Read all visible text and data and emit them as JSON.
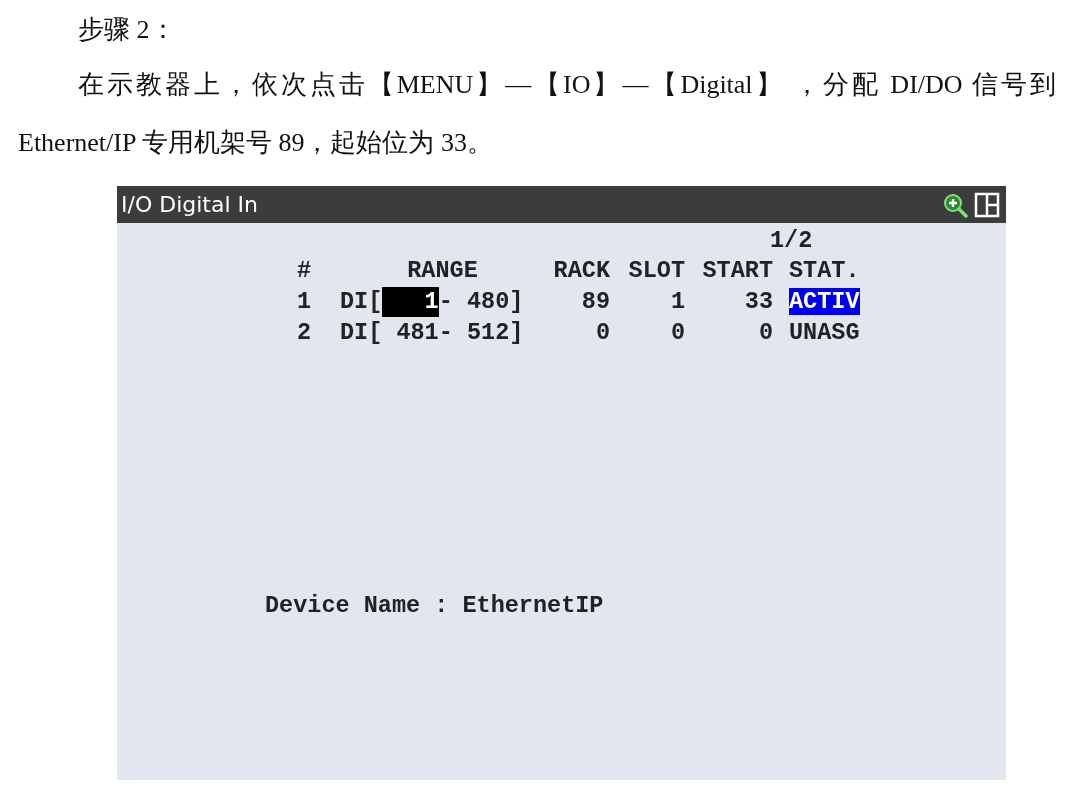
{
  "step_heading": "步骤 2：",
  "instruction": "在示教器上，依次点击【MENU】—【IO】—【Digital】 ，分配 DI/DO 信号到 Ethernet/IP 专用机架号 89，起始位为 33。",
  "screen": {
    "title": "I/O Digital In",
    "page": "1/2",
    "columns": [
      "#",
      "RANGE",
      "RACK",
      "SLOT",
      "START",
      "STAT."
    ],
    "rows": [
      {
        "index": "1",
        "range_prefix": "DI[",
        "range_start": "1",
        "range_suffix": "- 480]",
        "rack": "89",
        "slot": "1",
        "start": "33",
        "status": "ACTIV",
        "cursor": true,
        "status_selected": true
      },
      {
        "index": "2",
        "range_prefix": "DI[",
        "range_start": "481",
        "range_suffix": "- 512]",
        "rack": "0",
        "slot": "0",
        "start": "0",
        "status": "UNASG",
        "cursor": false,
        "status_selected": false
      }
    ],
    "device_label": "Device Name : EthernetIP"
  }
}
